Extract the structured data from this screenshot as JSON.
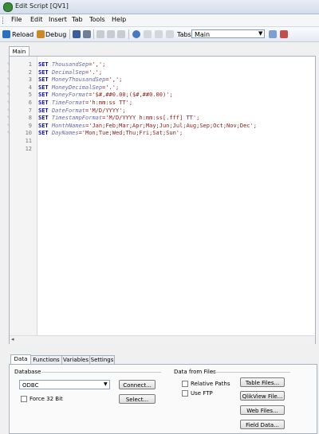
{
  "window": {
    "title": "Edit Script [QV1]"
  },
  "menu": [
    "File",
    "Edit",
    "Insert",
    "Tab",
    "Tools",
    "Help"
  ],
  "toolbar": {
    "reload": "Reload",
    "debug": "Debug",
    "tabs_label": "Tabs",
    "tab_select": "Main"
  },
  "editor": {
    "tab": "Main",
    "lines": [
      {
        "n": "1",
        "kw": "SET",
        "var": "ThousandSep",
        "val": "=',';"
      },
      {
        "n": "2",
        "kw": "SET",
        "var": "DecimalSep",
        "val": "='.';"
      },
      {
        "n": "3",
        "kw": "SET",
        "var": "MoneyThousandSep",
        "val": "=',';"
      },
      {
        "n": "4",
        "kw": "SET",
        "var": "MoneyDecimalSep",
        "val": "='.';"
      },
      {
        "n": "5",
        "kw": "SET",
        "var": "MoneyFormat",
        "val": "='$#,##0.00;($#,##0.00)';"
      },
      {
        "n": "6",
        "kw": "SET",
        "var": "TimeFormat",
        "val": "='h:mm:ss TT';"
      },
      {
        "n": "7",
        "kw": "SET",
        "var": "DateFormat",
        "val": "='M/D/YYYY';"
      },
      {
        "n": "8",
        "kw": "SET",
        "var": "TimestampFormat",
        "val": "='M/D/YYYY h:mm:ss[.fff] TT';"
      },
      {
        "n": "9",
        "kw": "SET",
        "var": "MonthNames",
        "val": "='Jan;Feb;Mar;Apr;May;Jun;Jul;Aug;Sep;Oct;Nov;Dec';"
      },
      {
        "n": "10",
        "kw": "SET",
        "var": "DayNames",
        "val": "='Mon;Tue;Wed;Thu;Fri;Sat;Sun';"
      },
      {
        "n": "11",
        "kw": "",
        "var": "",
        "val": ""
      },
      {
        "n": "12",
        "kw": "",
        "var": "",
        "val": ""
      }
    ]
  },
  "bottom_tabs": [
    "Data",
    "Functions",
    "Variables",
    "Settings"
  ],
  "database": {
    "group": "Database",
    "selected": "ODBC",
    "connect": "Connect...",
    "select": "Select...",
    "force32": "Force 32 Bit"
  },
  "files": {
    "group": "Data from Files",
    "relative_paths": "Relative Paths",
    "use_ftp": "Use FTP",
    "table_files": "Table Files...",
    "qlikview_file": "QlikView File...",
    "web_files": "Web Files...",
    "field_data": "Field Data..."
  },
  "colors": {
    "keyword": "#0000cc",
    "variable": "#6a6aa8",
    "string": "#8b1a1a"
  }
}
